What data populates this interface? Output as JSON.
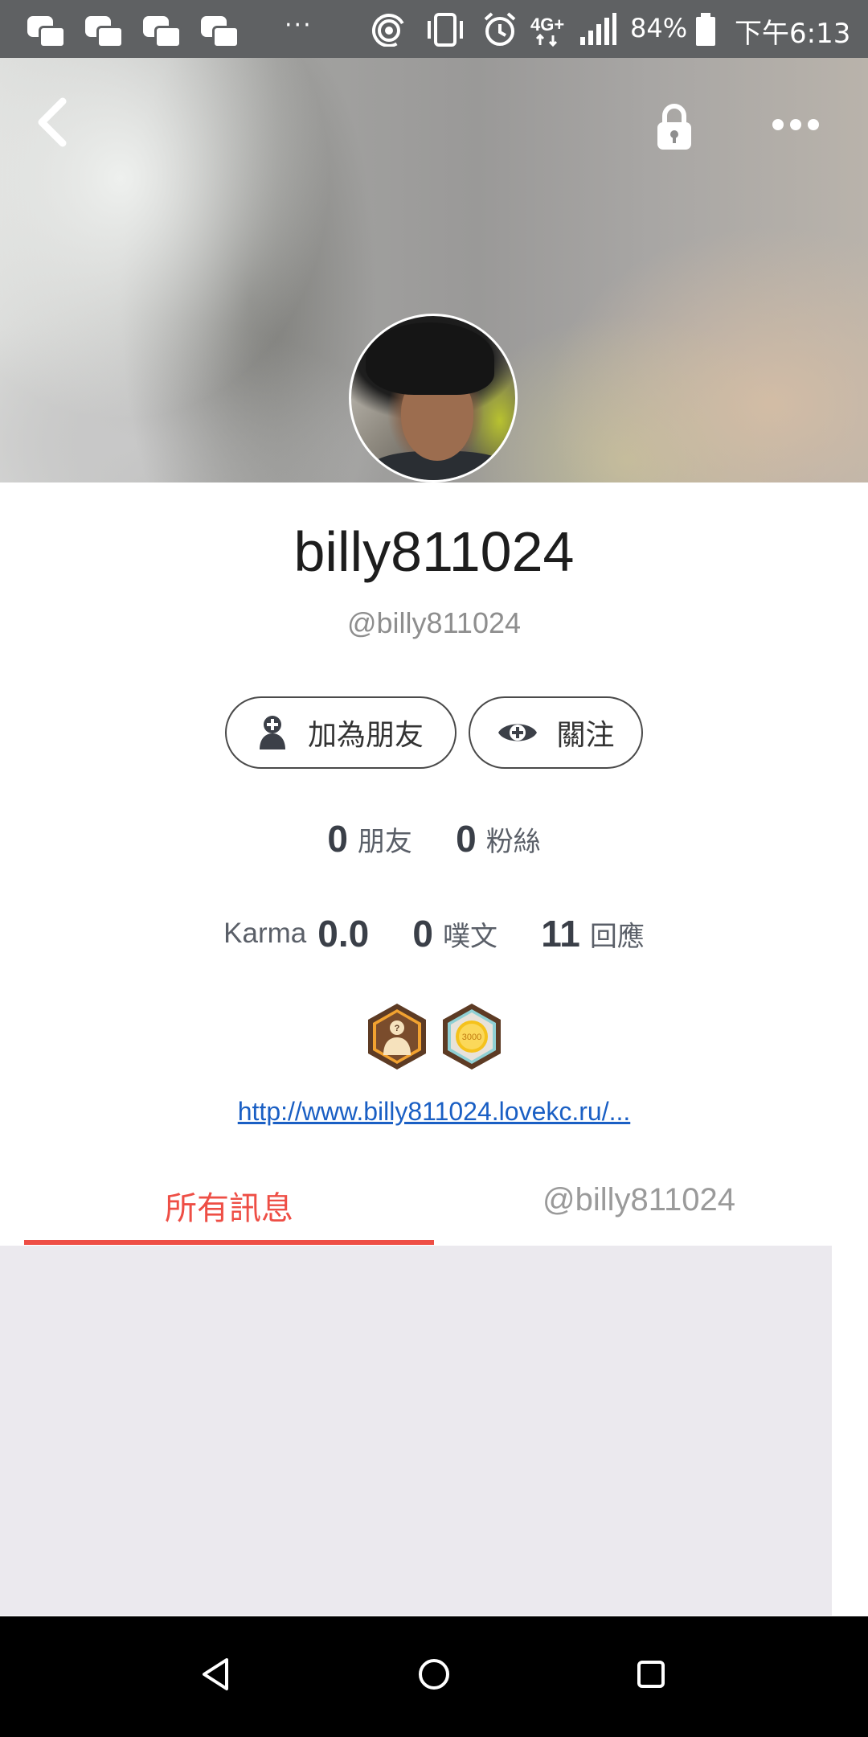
{
  "status_bar": {
    "battery": "84%",
    "time": "下午6:13",
    "network": "4G+"
  },
  "profile": {
    "display_name": "billy811024",
    "handle": "@billy811024",
    "add_friend_label": "加為朋友",
    "follow_label": "關注",
    "friends_count": "0",
    "friends_label": "朋友",
    "fans_count": "0",
    "fans_label": "粉絲",
    "karma_label": "Karma",
    "karma_value": "0.0",
    "posts_count": "0",
    "posts_label": "噗文",
    "replies_count": "11",
    "replies_label": "回應",
    "badges": [
      "badge-1",
      "badge-2"
    ],
    "badge2_text": "3000",
    "link_text": "http://www.billy811024.lovekc.ru/..."
  },
  "tabs": {
    "all": "所有訊息",
    "mentions": "@billy811024",
    "active": "all"
  },
  "colors": {
    "accent": "#ee4e45",
    "link": "#1a5fc4",
    "status_bar": "#5f6163"
  }
}
